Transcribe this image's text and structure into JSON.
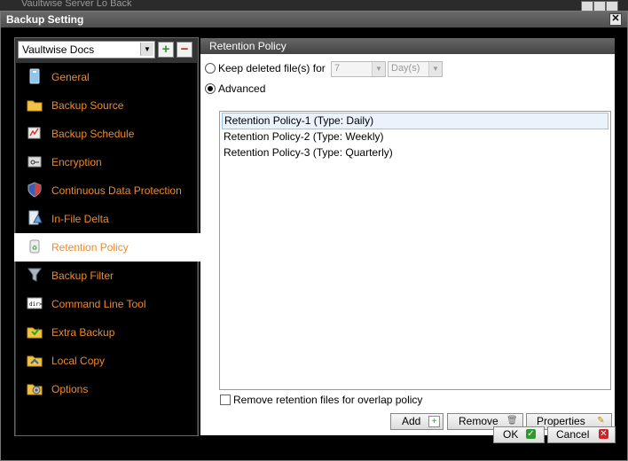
{
  "background_window": {
    "title": "Vaultwise Server Lo Back"
  },
  "window": {
    "title": "Backup Setting",
    "close_glyph": "✕"
  },
  "backup_set": {
    "selected": "Vaultwise Docs",
    "add_glyph": "+",
    "remove_glyph": "−"
  },
  "nav": {
    "items": [
      {
        "label": "General",
        "icon": "general-icon"
      },
      {
        "label": "Backup Source",
        "icon": "folder-icon"
      },
      {
        "label": "Backup Schedule",
        "icon": "schedule-icon"
      },
      {
        "label": "Encryption",
        "icon": "key-icon"
      },
      {
        "label": "Continuous Data Protection",
        "icon": "shield-icon"
      },
      {
        "label": "In-File Delta",
        "icon": "delta-icon"
      },
      {
        "label": "Retention Policy",
        "icon": "recycle-bin-icon"
      },
      {
        "label": "Backup Filter",
        "icon": "filter-icon"
      },
      {
        "label": "Command Line Tool",
        "icon": "terminal-icon"
      },
      {
        "label": "Extra Backup",
        "icon": "extra-backup-icon"
      },
      {
        "label": "Local Copy",
        "icon": "local-copy-icon"
      },
      {
        "label": "Options",
        "icon": "options-icon"
      }
    ],
    "selected_index": 6
  },
  "panel": {
    "title": "Retention Policy",
    "keep_deleted_label": "Keep deleted file(s) for",
    "keep_value": "7",
    "keep_unit": "Day(s)",
    "advanced_label": "Advanced",
    "policies": [
      "Retention Policy-1 (Type: Daily)",
      "Retention Policy-2 (Type: Weekly)",
      "Retention Policy-3 (Type: Quarterly)"
    ],
    "overlap_label": "Remove retention files for overlap policy",
    "add_label": "Add",
    "remove_label": "Remove",
    "properties_label": "Properties"
  },
  "footer": {
    "ok_label": "OK",
    "cancel_label": "Cancel"
  },
  "colors": {
    "accent": "#ee8a2a",
    "selected_row": "#eaf2fb",
    "ok_green": "#2e9a2e",
    "cancel_red": "#d42020"
  }
}
